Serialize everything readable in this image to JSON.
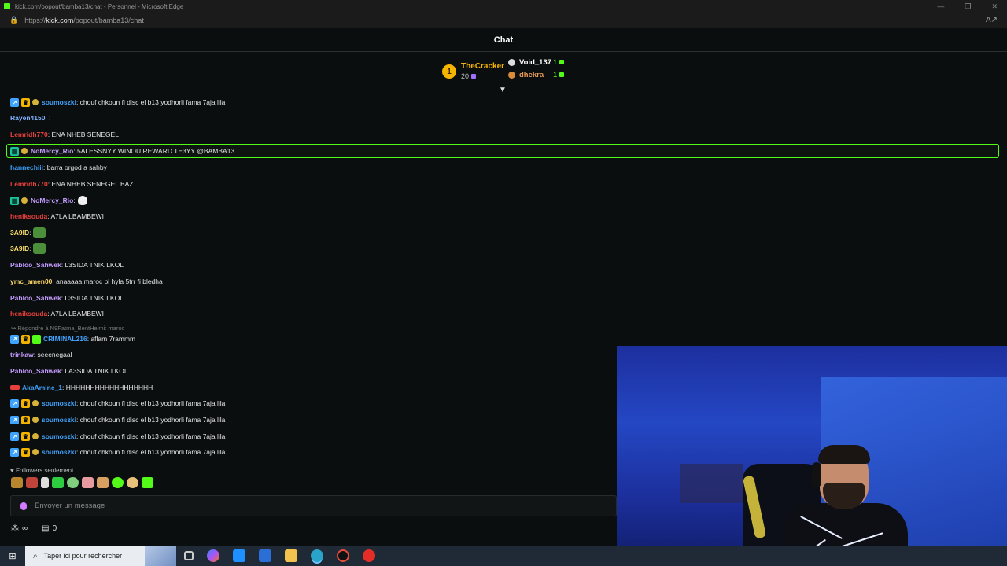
{
  "window": {
    "title": "kick.com/popout/bamba13/chat - Personnel - Microsoft Edge",
    "url_prefix": "https://",
    "url_domain": "kick.com",
    "url_path": "/popout/bamba13/chat"
  },
  "chat": {
    "header": "Chat",
    "leaderboard": {
      "first": {
        "rank": "1",
        "name": "TheCracker",
        "count": "20"
      },
      "second": {
        "name": "Void_137",
        "count": "1"
      },
      "third": {
        "name": "dhekra",
        "count": "1"
      }
    },
    "reply_context": "↪ Répondre à N9Fatma_BentHelmi: maroc",
    "messages": [
      {
        "user": "soumoszki",
        "color": "#3fa4ff",
        "text": ": chouf chkoun fi disc el b13 yodhorli fama 7aja lila"
      },
      {
        "user": "Rayen4150",
        "color": "#7fb2ff",
        "text": ": ;"
      },
      {
        "user": "Lemridh770",
        "color": "#e8403c",
        "text": ": ENA NHEB SENEGEL"
      },
      {
        "user": "NoMercy_Rio",
        "color": "#c39bff",
        "text": ": 5ALESSNYY WINOU REWARD TE3YY @BAMBA13"
      },
      {
        "user": "hannechiii",
        "color": "#3fa4ff",
        "text": ": barra orgod a sahby"
      },
      {
        "user": "Lemridh770",
        "color": "#e8403c",
        "text": ": ENA NHEB SENEGEL BAZ"
      },
      {
        "user": "NoMercy_Rio",
        "color": "#c39bff",
        "text": ":"
      },
      {
        "user": "heniksouda",
        "color": "#e8403c",
        "text": ": A7LA LBAMBEWI"
      },
      {
        "user": "3A9ID",
        "color": "#ffe36b",
        "text": ":"
      },
      {
        "user": "3A9ID",
        "color": "#ffe36b",
        "text": ":"
      },
      {
        "user": "Pabloo_Sahwek",
        "color": "#c39bff",
        "text": ": L3SIDA TNIK LKOL"
      },
      {
        "user": "ymc_amen00",
        "color": "#ffd96b",
        "text": ": anaaaaa maroc bl hyla 5trr fi bledha"
      },
      {
        "user": "Pabloo_Sahwek",
        "color": "#c39bff",
        "text": ": L3SIDA TNIK LKOL"
      },
      {
        "user": "heniksouda",
        "color": "#e8403c",
        "text": ": A7LA LBAMBEWI"
      },
      {
        "user": "CRIMINAL216",
        "color": "#3fa4ff",
        "text": ": aflam 7rammm"
      },
      {
        "user": "trinkaw",
        "color": "#c39bff",
        "text": ": seeenegaal"
      },
      {
        "user": "Pabloo_Sahwek",
        "color": "#c39bff",
        "text": ": LA3SIDA TNIK LKOL"
      },
      {
        "user": "AkaAmine_1",
        "color": "#3fa4ff",
        "text": ": HHHHHHHHHHHHHHHHHH"
      },
      {
        "user": "soumoszki",
        "color": "#3fa4ff",
        "text": ": chouf chkoun fi disc el b13 yodhorli fama 7aja lila"
      },
      {
        "user": "soumoszki",
        "color": "#3fa4ff",
        "text": ": chouf chkoun fi disc el b13 yodhorli fama 7aja lila"
      },
      {
        "user": "soumoszki",
        "color": "#3fa4ff",
        "text": ": chouf chkoun fi disc el b13 yodhorli fama 7aja lila"
      },
      {
        "user": "soumoszki",
        "color": "#3fa4ff",
        "text": ": chouf chkoun fi disc el b13 yodhorli fama 7aja lila"
      }
    ],
    "followers_only": "♥ Followers seulement",
    "composer_placeholder": "Envoyer un message",
    "footer": {
      "infinity": "∞",
      "count": "0"
    }
  },
  "taskbar": {
    "search_placeholder": "Taper ici pour rechercher"
  },
  "colors": {
    "accent": "#53fc18",
    "background": "#0b0e0f"
  }
}
